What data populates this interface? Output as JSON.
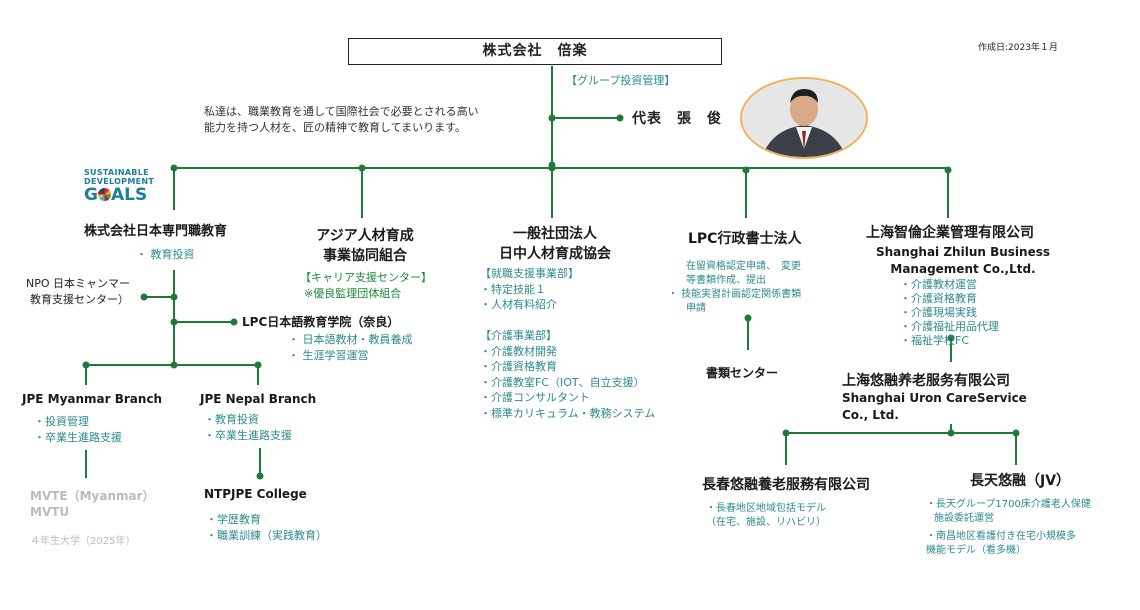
{
  "header": {
    "company": "株式会社　倍楽",
    "created_date": "作成日:2023年１月"
  },
  "group_mgmt": "【グループ投資管理】",
  "mission": [
    "私達は、職業教育を通して国際社会で必要とされる高い",
    "能力を持つ人材を、匠の精神で教育してまいります。"
  ],
  "representative": "代表　張　俊",
  "sdg": {
    "line1": "SUSTAINABLE",
    "line2": "DEVELOPMENT",
    "goals_g": "G",
    "goals_rest": "ALS"
  },
  "orgs": {
    "nihon": {
      "name": "株式会社日本専門職教育",
      "item": "・ 教育投資"
    },
    "npo": {
      "name": [
        "NPO 日本ミャンマー",
        "教育支援センター）"
      ]
    },
    "lpc_school": {
      "name": "LPC日本語教育学院（奈良）",
      "items": [
        "・ 日本語教材・教員養成",
        "・ 生涯学習運営"
      ]
    },
    "jpe_myanmar": {
      "name": "JPE Myanmar Branch",
      "items": [
        "・投資管理",
        "・卒業生進路支援"
      ]
    },
    "jpe_nepal": {
      "name": "JPE Nepal Branch",
      "items": [
        "・教育投資",
        "・卒業生進路支援"
      ]
    },
    "mvte": {
      "name": [
        "MVTE（Myanmar）",
        "MVTU"
      ],
      "note": "４年生大学（2025年）"
    },
    "ntpjpe": {
      "name": "NTPJPE College",
      "items": [
        "・学歴教育",
        "・職業訓練（実践教育）"
      ]
    },
    "asia": {
      "name": [
        "アジア人材育成",
        "事業協同組合"
      ],
      "items": [
        "【キャリア支援センター】",
        "※優良監理団体組合"
      ]
    },
    "ippan": {
      "name": [
        "一般社団法人",
        "日中人材育成協会"
      ],
      "items": [
        "【就職支援事業部】",
        "・特定技能１",
        "・人材有料紹介",
        "",
        "【介護事業部】",
        "・介護教材開発",
        "・介護資格教育",
        "・介護教室FC（IOT、自立支援）",
        "・介護コンサルタント",
        "・標準カリキュラム・教務システム"
      ]
    },
    "lpc_gyosei": {
      "name": "LPC行政書士法人",
      "items": [
        "在留資格認定申請、　変更",
        "等書類作成、提出",
        "・ 技能実習計画認定関係書類",
        "申請"
      ]
    },
    "shorui": {
      "name": "書類センター"
    },
    "shanghai_zhilun": {
      "name": [
        "上海智倫企業管理有限公司",
        "Shanghai Zhilun Business",
        "Management Co.,Ltd."
      ],
      "items": [
        "・介護教材運営",
        "・介護資格教育",
        "・介護現場実践",
        "・介護福祉用品代理",
        "・福祉学校FC"
      ]
    },
    "shanghai_uron": {
      "name": [
        "上海悠融养老服务有限公司",
        "Shanghai Uron CareService",
        "Co., Ltd."
      ]
    },
    "changchun": {
      "name": "長春悠融養老服務有限公司",
      "items": [
        "・長春地区地域包括モデル",
        "（在宅、施設、リハビリ）"
      ]
    },
    "changtian": {
      "name": "長天悠融（JV）",
      "items": [
        "・長天グループ1700床介護老人保健",
        "施設委託運営",
        "・南昌地区看護付き在宅小規模多",
        "機能モデル（看多機）"
      ]
    }
  },
  "colors": {
    "line": "#1f7a3a",
    "teal_text": "#2e8b8b",
    "dot": "#1f7a3a",
    "photo_border": "#f0b25a"
  }
}
